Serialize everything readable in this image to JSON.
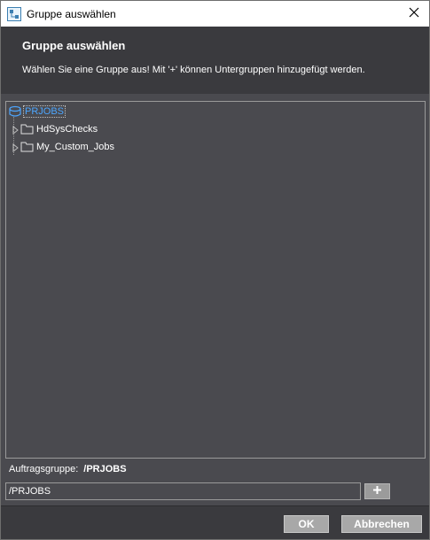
{
  "window": {
    "title": "Gruppe auswählen",
    "icon": "app-icon",
    "close_icon": "close-icon"
  },
  "header": {
    "title": "Gruppe auswählen",
    "description": "Wählen Sie eine Gruppe aus! Mit '+' können Untergruppen hinzugefügt werden."
  },
  "tree": {
    "root": {
      "label": "PRJOBS",
      "icon": "database-icon",
      "selected": true
    },
    "children": [
      {
        "label": "HdSysChecks",
        "icon": "folder-icon",
        "expanded": false
      },
      {
        "label": "My_Custom_Jobs",
        "icon": "folder-icon",
        "expanded": false
      }
    ]
  },
  "selection": {
    "label": "Auftragsgruppe:",
    "value": "/PRJOBS"
  },
  "path_input": {
    "value": "/PRJOBS"
  },
  "add_button": {
    "label": "+",
    "icon": "plus-icon"
  },
  "footer": {
    "ok_label": "OK",
    "cancel_label": "Abbrechen"
  },
  "colors": {
    "panel": "#4a4a4f",
    "header": "#3a3a3e",
    "root_label": "#4da6ff",
    "button": "#a8a8a8"
  }
}
